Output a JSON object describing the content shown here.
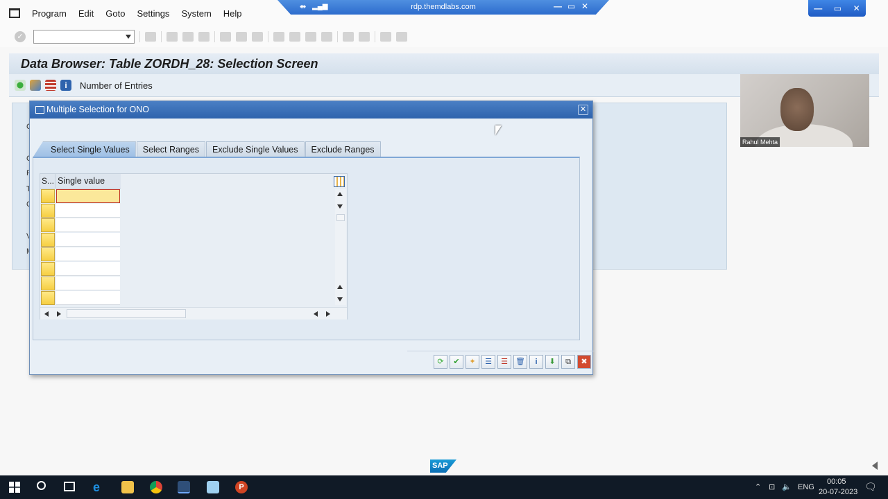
{
  "menu": {
    "items": [
      "Program",
      "Edit",
      "Goto",
      "Settings",
      "System",
      "Help"
    ]
  },
  "rdp": {
    "host": "rdp.themdlabs.com",
    "pin_glyph": "⇹",
    "signal_glyph": "📶",
    "min_glyph": "—",
    "restore_glyph": "▭",
    "close_glyph": "✕"
  },
  "window_controls": {
    "min": "—",
    "restore": "▭",
    "close": "✕"
  },
  "toolbar": {
    "check_glyph": "✓",
    "command_value": ""
  },
  "screen": {
    "title": "Data Browser: Table ZORDH_28: Selection Screen",
    "appbar_label": "Number of Entries"
  },
  "webcam": {
    "name": "Rahul Mehta"
  },
  "dialog": {
    "title": "Multiple Selection for ONO",
    "close_glyph": "✕",
    "tabs": [
      {
        "label": "Select Single Values",
        "active": true
      },
      {
        "label": "Select Ranges",
        "active": false
      },
      {
        "label": "Exclude Single Values",
        "active": false
      },
      {
        "label": "Exclude Ranges",
        "active": false
      }
    ],
    "grid": {
      "col_status": "S...",
      "col_value": "Single value",
      "rows": [
        "",
        "",
        "",
        "",
        "",
        "",
        "",
        ""
      ]
    },
    "footer": {
      "ok": "✔",
      "cancel": "✖",
      "info": "i"
    }
  },
  "taskbar": {
    "lang": "ENG",
    "time": "00:05",
    "date": "20-07-2023"
  },
  "brand": {
    "sap": "SAP"
  },
  "colors": {
    "title_blue": "#2e63ad",
    "accent_yellow": "#f6cf43",
    "taskbar": "#101a26"
  }
}
